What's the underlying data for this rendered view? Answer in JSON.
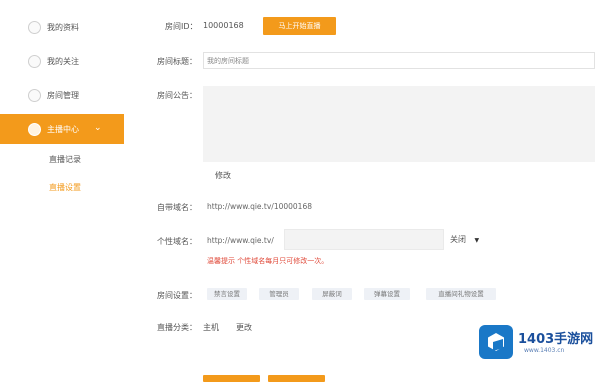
{
  "sidebar": {
    "items": [
      {
        "label": "我的资料",
        "icon": "user-icon"
      },
      {
        "label": "我的关注",
        "icon": "heart-icon"
      },
      {
        "label": "房间管理",
        "icon": "home-icon"
      },
      {
        "label": "主播中心",
        "icon": "broadcaster-icon"
      }
    ],
    "sub_items": [
      {
        "label": "直播记录"
      },
      {
        "label": "直播设置"
      }
    ]
  },
  "form": {
    "room_id_label": "房间ID：",
    "room_id_value": "10000168",
    "room_id_button": "马上开始直播",
    "room_title_label": "房间标题：",
    "room_title_value": "我的房间标题",
    "announcement_label": "房间公告：",
    "edit_label": "修改",
    "address_label": "自带域名：",
    "address_value": "http://www.qie.tv/10000168",
    "custom_domain_label": "个性域名：",
    "custom_domain_prefix": "http://www.qie.tv/",
    "custom_domain_select": "关闭",
    "warning_text": "温馨提示   个性域名每月只可修改一次。",
    "settings_label": "房间设置：",
    "settings_options": [
      "禁言设置",
      "管理员",
      "屏蔽词",
      "弹幕设置",
      "直播间礼物设置"
    ],
    "category_label": "直播分类：",
    "category_value": "主机",
    "category_change": "更改"
  },
  "watermark": {
    "title": "1403手游网",
    "url": "www.1403.cn"
  },
  "colors": {
    "accent": "#f39a1b",
    "warning": "#e04a3a",
    "watermark_blue": "#1a78c7"
  }
}
